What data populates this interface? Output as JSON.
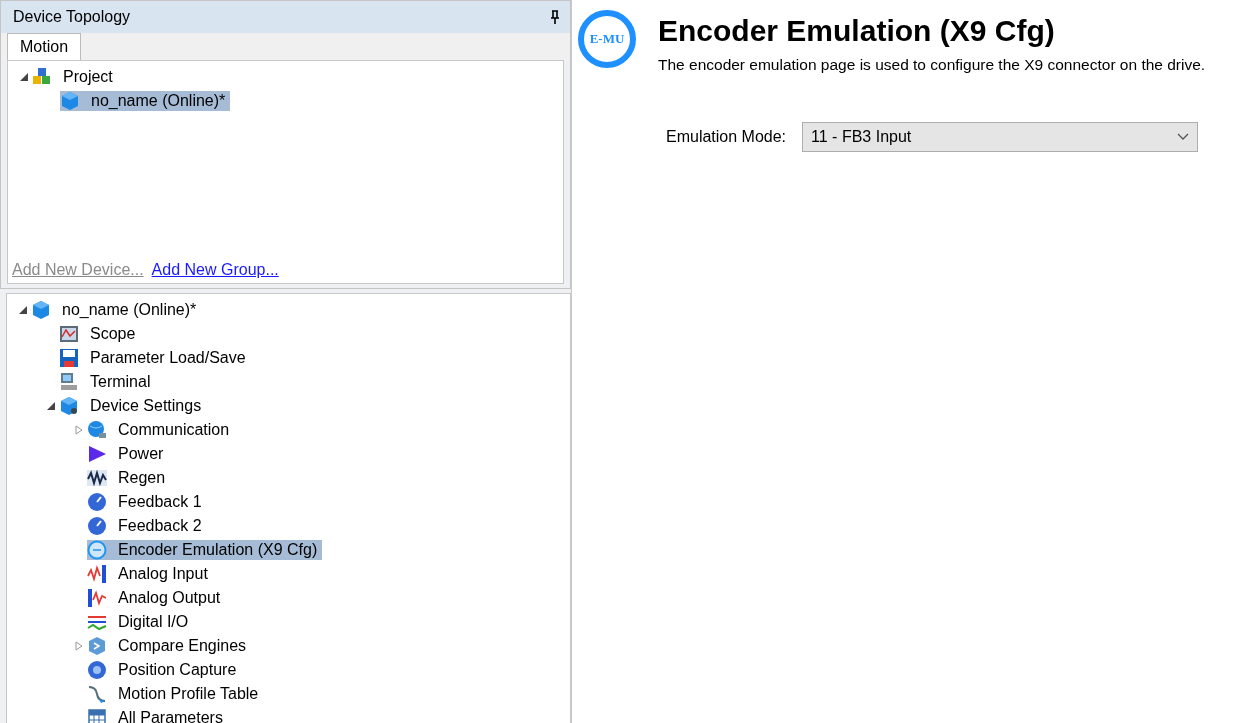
{
  "topology": {
    "title": "Device Topology",
    "tabs": [
      {
        "label": "Motion",
        "selected": true
      }
    ],
    "tree": [
      {
        "label": "Project",
        "kind": "project",
        "expanded": true,
        "selected": false,
        "children": [
          {
            "label": "no_name (Online)*",
            "kind": "device",
            "selected": true
          }
        ]
      }
    ],
    "links": [
      {
        "label": "Add New Device...",
        "disabled": true
      },
      {
        "label": "Add New Group...",
        "disabled": false
      }
    ]
  },
  "device_tree": [
    {
      "label": "no_name (Online)*",
      "kind": "device",
      "expanded": true,
      "selected": false,
      "children": [
        {
          "label": "Scope",
          "kind": "scope",
          "selected": false
        },
        {
          "label": "Parameter Load/Save",
          "kind": "floppy",
          "selected": false
        },
        {
          "label": "Terminal",
          "kind": "terminal",
          "selected": false
        },
        {
          "label": "Device Settings",
          "kind": "settings",
          "expanded": true,
          "selected": false,
          "children": [
            {
              "label": "Communication",
              "kind": "globe",
              "expanded": false,
              "selected": false
            },
            {
              "label": "Power",
              "kind": "power",
              "selected": false
            },
            {
              "label": "Regen",
              "kind": "wave",
              "selected": false
            },
            {
              "label": "Feedback 1",
              "kind": "gauge",
              "selected": false
            },
            {
              "label": "Feedback 2",
              "kind": "gauge",
              "selected": false
            },
            {
              "label": "Encoder Emulation (X9 Cfg)",
              "kind": "encoder",
              "selected": true
            },
            {
              "label": "Analog Input",
              "kind": "analog_in",
              "selected": false
            },
            {
              "label": "Analog Output",
              "kind": "analog_out",
              "selected": false
            },
            {
              "label": "Digital I/O",
              "kind": "digital",
              "selected": false
            },
            {
              "label": "Compare Engines",
              "kind": "compare",
              "expanded": false,
              "selected": false
            },
            {
              "label": "Position Capture",
              "kind": "capture",
              "selected": false
            },
            {
              "label": "Motion Profile Table",
              "kind": "profile",
              "selected": false
            },
            {
              "label": "All Parameters",
              "kind": "table",
              "selected": false
            }
          ]
        }
      ]
    }
  ],
  "page": {
    "logo": "E-MU",
    "title": "Encoder Emulation (X9 Cfg)",
    "description": "The encoder emulation page is used to configure the X9 connector on the drive.",
    "fields": [
      {
        "label": "Emulation Mode:",
        "value": "11 - FB3 Input"
      }
    ]
  }
}
